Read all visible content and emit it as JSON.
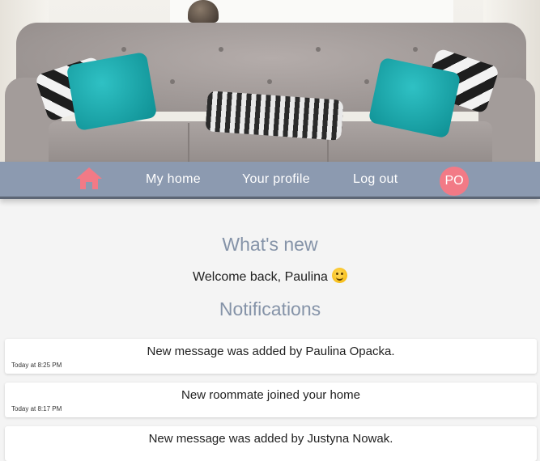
{
  "nav": {
    "home_icon": "home-icon",
    "links": [
      "My home",
      "Your profile",
      "Log out"
    ],
    "avatar_initials": "PO"
  },
  "main": {
    "whats_new_title": "What's new",
    "welcome_text": "Welcome back, Paulina",
    "welcome_emoji": "smiley-icon",
    "notifications_title": "Notifications"
  },
  "notifications": [
    {
      "message": "New message was added by Paulina Opacka.",
      "time": "Today at 8:25 PM"
    },
    {
      "message": "New roommate joined your home",
      "time": "Today at 8:17 PM"
    },
    {
      "message": "New message was added by Justyna Nowak.",
      "time": ""
    }
  ],
  "colors": {
    "navbar": "#8c9ab0",
    "accent": "#f27a86",
    "title": "#8593a8"
  }
}
